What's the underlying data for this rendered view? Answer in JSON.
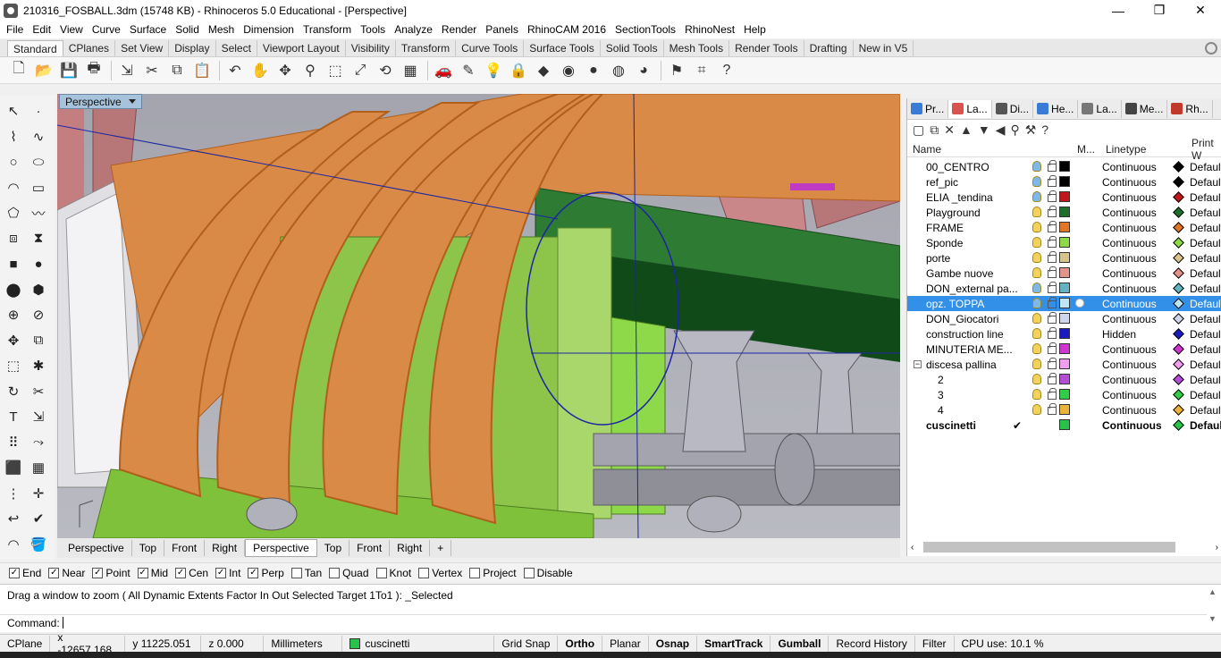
{
  "window": {
    "title": "210316_FOSBALL.3dm (15748 KB) - Rhinoceros 5.0 Educational - [Perspective]",
    "min": "—",
    "max": "❐",
    "close": "✕"
  },
  "menu": [
    "File",
    "Edit",
    "View",
    "Curve",
    "Surface",
    "Solid",
    "Mesh",
    "Dimension",
    "Transform",
    "Tools",
    "Analyze",
    "Render",
    "Panels",
    "RhinoCAM 2016",
    "SectionTools",
    "RhinoNest",
    "Help"
  ],
  "toolbar_tabs": [
    "Standard",
    "CPlanes",
    "Set View",
    "Display",
    "Select",
    "Viewport Layout",
    "Visibility",
    "Transform",
    "Curve Tools",
    "Surface Tools",
    "Solid Tools",
    "Mesh Tools",
    "Render Tools",
    "Drafting",
    "New in V5"
  ],
  "toolbar_icons": [
    "new-icon",
    "open-icon",
    "save-icon",
    "print-icon",
    "import-icon",
    "cut-icon",
    "copy-icon",
    "paste-icon",
    "undo-icon",
    "pan-icon",
    "rotate-icon",
    "zoom-icon",
    "zoom-window-icon",
    "zoom-extents-icon",
    "zoom-selected-icon",
    "viewports-icon",
    "car-icon",
    "object-properties-icon",
    "lightbulb-icon",
    "lock-icon",
    "render-icon",
    "color-wheel-icon",
    "sphere-icon",
    "render-sphere-icon",
    "rendered-sphere-icon",
    "snap-icon",
    "grid-icon",
    "help-icon"
  ],
  "viewport": {
    "label": "Perspective",
    "tabs": [
      "Perspective",
      "Top",
      "Front",
      "Right",
      "Perspective",
      "Top",
      "Front",
      "Right"
    ],
    "active_tab": 4,
    "add": "+"
  },
  "panel": {
    "tabs": [
      {
        "label": "Pr...",
        "color": "#3a7bd5"
      },
      {
        "label": "La...",
        "color": "#d9534f"
      },
      {
        "label": "Di...",
        "color": "#555555"
      },
      {
        "label": "He...",
        "color": "#3a7bd5"
      },
      {
        "label": "La...",
        "color": "#777777"
      },
      {
        "label": "Me...",
        "color": "#444444"
      },
      {
        "label": "Rh...",
        "color": "#c0392b"
      }
    ],
    "headers": {
      "name": "Name",
      "m": "M...",
      "linetype": "Linetype",
      "print": "Print W"
    },
    "layers": [
      {
        "name": "00_CENTRO",
        "color": "#000000",
        "linetype": "Continuous",
        "print": "Default",
        "diamond": "#000000"
      },
      {
        "name": "ref_pic",
        "color": "#000000",
        "linetype": "Continuous",
        "print": "Default",
        "diamond": "#000000"
      },
      {
        "name": "ELIA _tendina",
        "color": "#c0171c",
        "linetype": "Continuous",
        "print": "Default",
        "diamond": "#c0171c"
      },
      {
        "name": "Playground",
        "color": "#1f6e2c",
        "linetype": "Continuous",
        "print": "Default",
        "diamond": "#1f6e2c"
      },
      {
        "name": "FRAME",
        "color": "#e27626",
        "linetype": "Continuous",
        "print": "Default",
        "diamond": "#e27626"
      },
      {
        "name": "Sponde",
        "color": "#8ed94a",
        "linetype": "Continuous",
        "print": "Default",
        "diamond": "#8ed94a"
      },
      {
        "name": "porte",
        "color": "#d8c58c",
        "linetype": "Continuous",
        "print": "Default",
        "diamond": "#d8c58c"
      },
      {
        "name": "Gambe nuove",
        "color": "#e1928c",
        "linetype": "Continuous",
        "print": "Default",
        "diamond": "#e1928c"
      },
      {
        "name": "DON_external pa...",
        "color": "#65b3c1",
        "linetype": "Continuous",
        "print": "Default",
        "diamond": "#65b3c1"
      },
      {
        "name": "opz. TOPPA",
        "color": "#bfe4f4",
        "linetype": "Continuous",
        "print": "Default",
        "diamond": "#bfe4f4"
      },
      {
        "name": "DON_Giocatori",
        "color": "#cfd6ec",
        "linetype": "Continuous",
        "print": "Default",
        "diamond": "#cfd6ec"
      },
      {
        "name": "construction line",
        "color": "#1b1bbf",
        "linetype": "Hidden",
        "print": "Default",
        "diamond": "#1b1bbf"
      },
      {
        "name": "MINUTERIA ME...",
        "color": "#cf35cf",
        "linetype": "Continuous",
        "print": "Default",
        "diamond": "#cf35cf"
      },
      {
        "name": "discesa pallina",
        "color": "#f09ef0",
        "linetype": "Continuous",
        "print": "Default",
        "diamond": "#f09ef0"
      },
      {
        "name": "2",
        "color": "#b54ed6",
        "linetype": "Continuous",
        "print": "Default",
        "diamond": "#b54ed6"
      },
      {
        "name": "3",
        "color": "#2fce46",
        "linetype": "Continuous",
        "print": "Default",
        "diamond": "#2fce46"
      },
      {
        "name": "4",
        "color": "#ecb33a",
        "linetype": "Continuous",
        "print": "Default",
        "diamond": "#ecb33a"
      },
      {
        "name": "cuscinetti",
        "color": "#28c24a",
        "linetype": "Continuous",
        "print": "Default",
        "diamond": "#28c24a"
      }
    ],
    "selected_index": 9,
    "current_check": "✔"
  },
  "osnaps": [
    {
      "label": "End",
      "checked": true
    },
    {
      "label": "Near",
      "checked": true
    },
    {
      "label": "Point",
      "checked": true
    },
    {
      "label": "Mid",
      "checked": true
    },
    {
      "label": "Cen",
      "checked": true
    },
    {
      "label": "Int",
      "checked": true
    },
    {
      "label": "Perp",
      "checked": true
    },
    {
      "label": "Tan",
      "checked": false
    },
    {
      "label": "Quad",
      "checked": false
    },
    {
      "label": "Knot",
      "checked": false
    },
    {
      "label": "Vertex",
      "checked": false
    },
    {
      "label": "Project",
      "checked": false
    },
    {
      "label": "Disable",
      "checked": false
    }
  ],
  "command": {
    "history": "Drag a window to zoom ( All  Dynamic  Extents  Factor  In  Out  Selected  Target  1To1 ): _Selected",
    "prompt": "Command:"
  },
  "status": {
    "cplane": "CPlane",
    "x": "x -12657.168",
    "y": "y 11225.051",
    "z": "z 0.000",
    "units": "Millimeters",
    "layer": "cuscinetti",
    "layer_color": "#28c24a",
    "grid_snap": "Grid Snap",
    "ortho": "Ortho",
    "planar": "Planar",
    "osnap": "Osnap",
    "smarttrack": "SmartTrack",
    "gumball": "Gumball",
    "record_history": "Record History",
    "filter": "Filter",
    "cpu": "CPU use: 10.1 %"
  }
}
